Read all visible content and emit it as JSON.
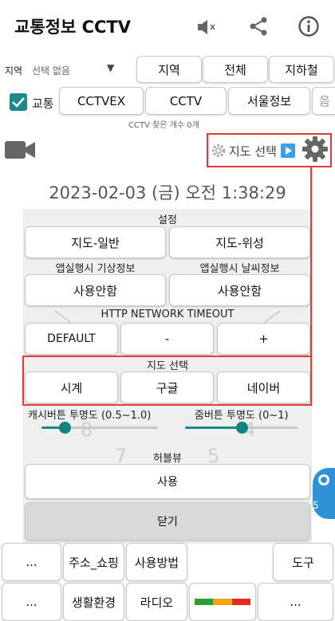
{
  "header": {
    "title": "교통정보 CCTV",
    "mute_icon": "speaker-mute-icon",
    "share_icon": "share-icon",
    "info_icon": "info-icon"
  },
  "region": {
    "label": "지역",
    "select_value": "선택 없음",
    "buttons": [
      "지역",
      "전체",
      "지하철"
    ]
  },
  "traffic": {
    "checkbox_label": "교통",
    "checked": true,
    "buttons": [
      "CCTVEX",
      "CCTV",
      "서울정보",
      "음"
    ],
    "count_text": "CCTV 찾은 개수 0개"
  },
  "toolbar": {
    "video_icon": "video-camera-icon",
    "map_select_label": "지도 선택",
    "gear_icon": "gear-icon"
  },
  "datetime": "2023-02-03 (금) 오전 1:38:29",
  "settings": {
    "section_title": "설정",
    "map_buttons": [
      "지도-일반",
      "지도-위성"
    ],
    "weather_caption_left": "앱실행시 기상정보",
    "weather_caption_right": "앱실행시 날씨정보",
    "weather_buttons": [
      "사용안함",
      "사용안함"
    ],
    "timeout_title": "HTTP NETWORK TIMEOUT",
    "timeout_buttons": [
      "DEFAULT",
      "-",
      "+"
    ],
    "map_select_title": "지도 선택",
    "map_select_buttons": [
      "시계",
      "구글",
      "네이버"
    ],
    "cache_opacity_label": "캐시버튼 투명도 (0.5~1.0)",
    "cache_opacity_value": 0.6,
    "zoom_opacity_label": "줌버튼 투명도 (0~1)",
    "zoom_opacity_value": 0.5,
    "hubble_title": "허블뷰",
    "hubble_button": "사용",
    "close_button": "닫기"
  },
  "clock": {
    "numerals": [
      "8",
      "4",
      "7",
      "5"
    ]
  },
  "bottom_bar": {
    "row1": [
      "...",
      "주소_쇼핑",
      "사용방법",
      "도구"
    ],
    "row2": [
      "...",
      "생활환경",
      "라디오",
      "..."
    ],
    "traffic_colors": [
      "#2e9c35",
      "#f2a30f",
      "#e8271e"
    ]
  },
  "floating_badge": "5",
  "colors": {
    "accent": "#13817f",
    "highlight": "#e53935",
    "checkbox": "#1a8b8c"
  }
}
